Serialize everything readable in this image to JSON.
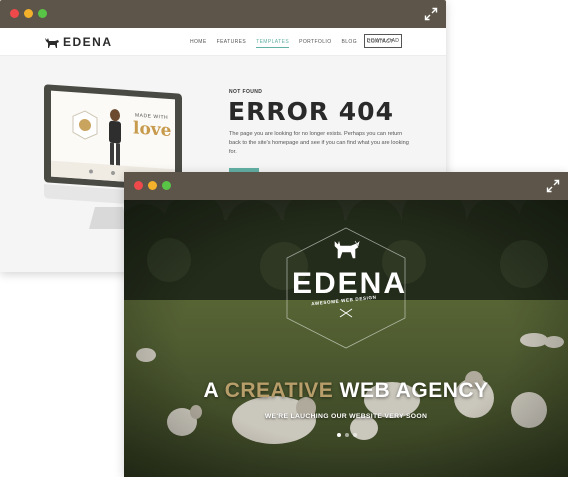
{
  "colors": {
    "titlebar": "#5d5549",
    "dot_close": "#f0494b",
    "dot_min": "#f3b02a",
    "dot_max": "#59c546",
    "accent_teal": "#63b0a5",
    "accent_gold": "#b79e6a"
  },
  "icons": {
    "expand": "expand-arrows-icon",
    "logo": "deer-icon"
  },
  "back_window": {
    "brand": "EDENA",
    "menu": [
      "HOME",
      "FEATURES",
      "TEMPLATES",
      "PORTFOLIO",
      "BLOG",
      "CONTACT"
    ],
    "active_menu": "TEMPLATES",
    "download_label": "DOWNLOAD",
    "not_found_label": "NOT FOUND",
    "error_title": "ERROR 404",
    "error_message": "The page you are looking for no longer exists. Perhaps you can return back to the site's homepage and see if you can find what you are looking for.",
    "monitor_caption_small": "MADE WITH",
    "monitor_caption_big": "love"
  },
  "front_window": {
    "brand": "EDENA",
    "tagline": "AWESOME WEB DESIGN",
    "headline_prefix": "A ",
    "headline_accent": "CREATIVE",
    "headline_suffix": " WEB AGENCY",
    "subheadline": "WE'RE LAUCHING OUR WEBSITE VERY SOON",
    "slides_total": 3,
    "slide_active": 1
  }
}
